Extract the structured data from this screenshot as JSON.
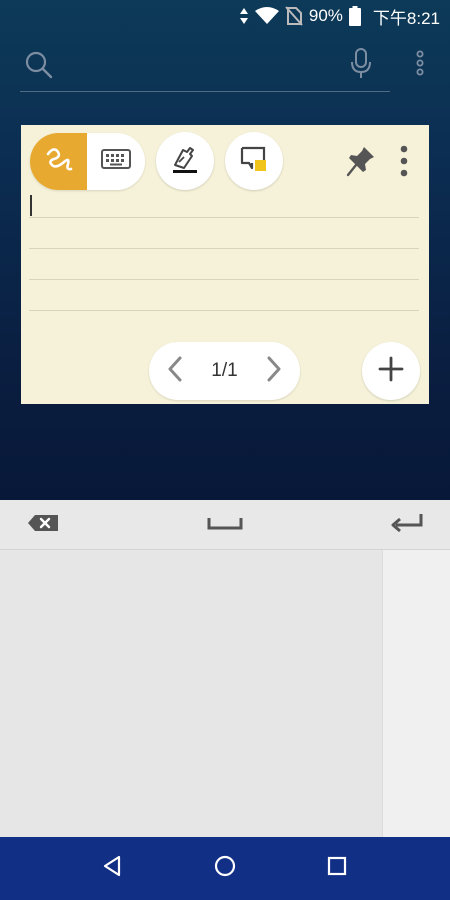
{
  "status_bar": {
    "battery": "90%",
    "time": "下午8:21"
  },
  "search": {
    "placeholder": ""
  },
  "note": {
    "pager_label": "1/1"
  },
  "colors": {
    "accent": "#e8a930",
    "note_bg": "#f6f2d9",
    "navbar": "#122f86",
    "square_accent": "#f0c419"
  },
  "icons": {
    "status": [
      "data-arrows-icon",
      "wifi-icon",
      "no-sim-icon",
      "battery-icon"
    ],
    "search": "search-icon",
    "mic": "mic-icon",
    "more": "more-vertical-icon",
    "note_tools": [
      "handwriting-icon",
      "keyboard-icon",
      "pen-icon",
      "color-note-icon",
      "pin-icon",
      "more-vertical-icon"
    ],
    "pager": [
      "chevron-left-icon",
      "chevron-right-icon"
    ],
    "add": "plus-icon",
    "keyboard": [
      "backspace-icon",
      "space-icon",
      "enter-icon"
    ],
    "nav": [
      "back-icon",
      "home-icon",
      "recents-icon"
    ]
  }
}
